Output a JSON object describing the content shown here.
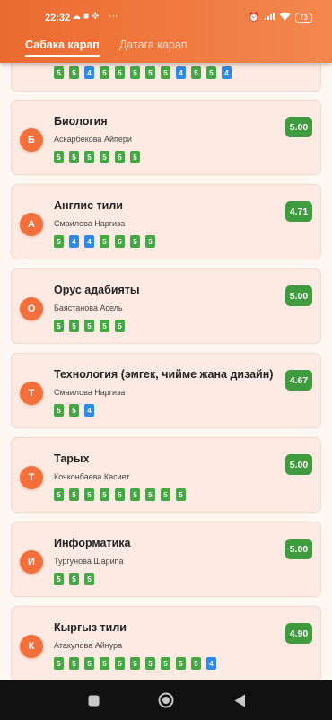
{
  "status_bar": {
    "time": "22:32",
    "battery": "73"
  },
  "tabs": [
    "Сабака карап",
    "Датага карап"
  ],
  "cards": [
    {
      "initial": "",
      "subject": "",
      "teacher": "",
      "average": "",
      "grades": [
        "5",
        "5",
        "4",
        "5",
        "5",
        "5",
        "5",
        "5",
        "4",
        "5",
        "5",
        "4"
      ]
    },
    {
      "initial": "Б",
      "subject": "Биология",
      "teacher": "Аскарбекова Айпери",
      "average": "5.00",
      "grades": [
        "5",
        "5",
        "5",
        "5",
        "5",
        "5"
      ]
    },
    {
      "initial": "А",
      "subject": "Англис тили",
      "teacher": "Смаилова Наргиза",
      "average": "4.71",
      "grades": [
        "5",
        "4",
        "4",
        "5",
        "5",
        "5",
        "5"
      ]
    },
    {
      "initial": "О",
      "subject": "Орус адабияты",
      "teacher": "Баястанова Асель",
      "average": "5.00",
      "grades": [
        "5",
        "5",
        "5",
        "5",
        "5"
      ]
    },
    {
      "initial": "Т",
      "subject": "Технология (эмгек, чийме жана дизайн)",
      "teacher": "Смаилова Наргиза",
      "average": "4.67",
      "grades": [
        "5",
        "5",
        "4"
      ]
    },
    {
      "initial": "Т",
      "subject": "Тарых",
      "teacher": "Кочконбаева Касиет",
      "average": "5.00",
      "grades": [
        "5",
        "5",
        "5",
        "5",
        "5",
        "5",
        "5",
        "5",
        "5"
      ]
    },
    {
      "initial": "И",
      "subject": "Информатика",
      "teacher": "Тургунова Шарипа",
      "average": "5.00",
      "grades": [
        "5",
        "5",
        "5"
      ]
    },
    {
      "initial": "К",
      "subject": "Кыргыз тили",
      "teacher": "Атакулова Айнура",
      "average": "4.90",
      "grades": [
        "5",
        "5",
        "5",
        "5",
        "5",
        "5",
        "5",
        "5",
        "5",
        "5",
        "4"
      ]
    }
  ]
}
